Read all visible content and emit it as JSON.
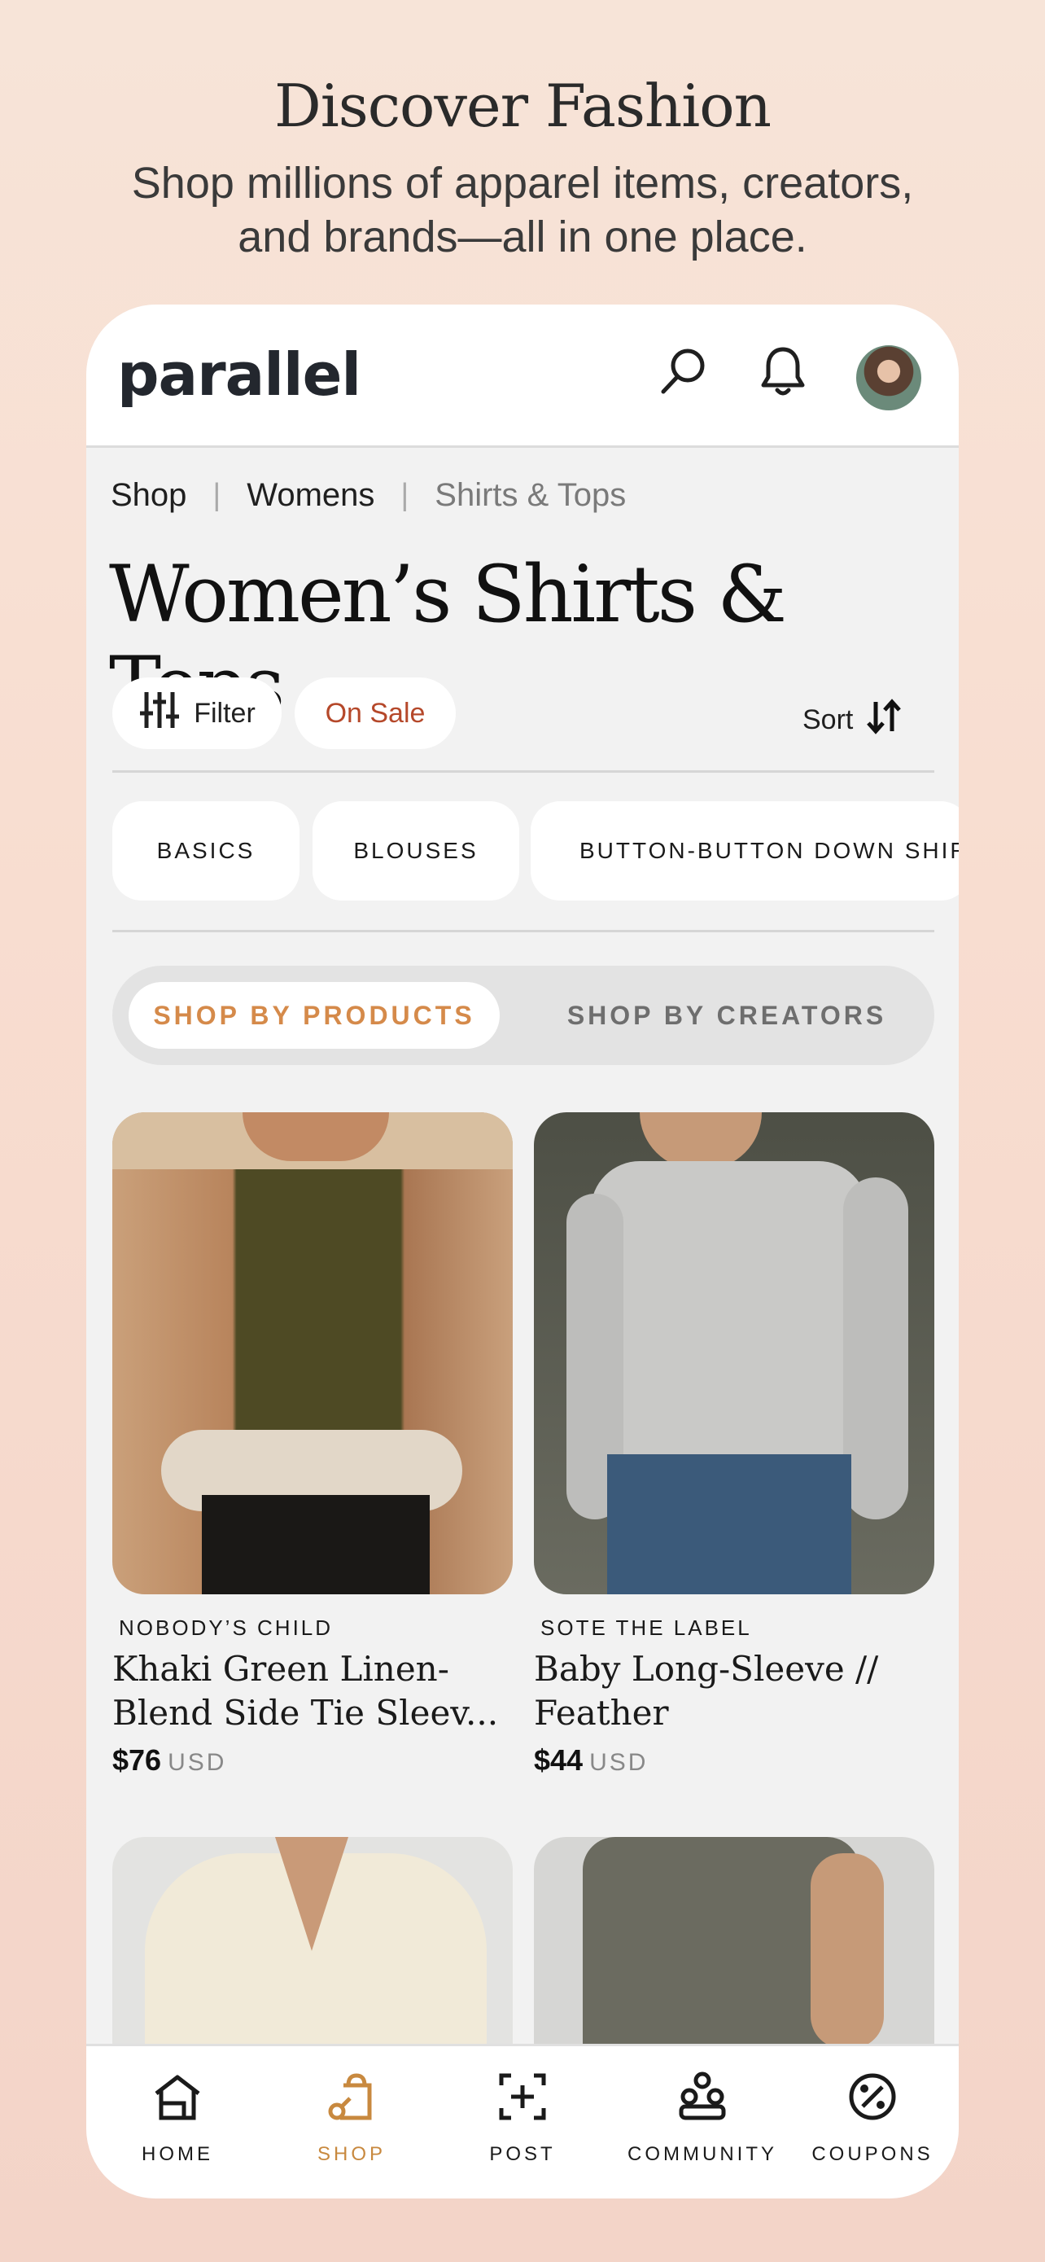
{
  "hero": {
    "title": "Discover Fashion",
    "subtitle": "Shop millions of apparel items, creators, and brands—all in one place."
  },
  "header": {
    "logo": "parallel",
    "search_icon": "search-icon",
    "notifications_icon": "bell-icon",
    "avatar": "avatar"
  },
  "breadcrumb": {
    "items": [
      "Shop",
      "Womens",
      "Shirts & Tops"
    ],
    "separator": "|"
  },
  "page": {
    "title": "Women’s Shirts & Tops"
  },
  "toolbar": {
    "filter_label": "Filter",
    "sale_label": "On Sale",
    "sort_label": "Sort"
  },
  "categories": [
    "BASICS",
    "BLOUSES",
    "BUTTON-BUTTON DOWN SHIRS"
  ],
  "segmented": {
    "products": "SHOP BY PRODUCTS",
    "creators": "SHOP BY CREATORS",
    "active": "products"
  },
  "products": [
    {
      "brand": "NOBODY’S CHILD",
      "name": "Khaki Green Linen-Blend Side Tie Sleev...",
      "price": "$76",
      "currency": "USD"
    },
    {
      "brand": "SOTE THE LABEL",
      "name": "Baby Long-Sleeve // Feather",
      "price": "$44",
      "currency": "USD"
    }
  ],
  "nav": {
    "items": [
      {
        "label": "HOME",
        "icon": "home-icon"
      },
      {
        "label": "SHOP",
        "icon": "shop-icon"
      },
      {
        "label": "POST",
        "icon": "post-icon"
      },
      {
        "label": "COMMUNITY",
        "icon": "community-icon"
      },
      {
        "label": "COUPONS",
        "icon": "coupons-icon"
      }
    ],
    "active": "SHOP"
  },
  "colors": {
    "accent": "#d58a4a",
    "sale": "#b5482a",
    "background": "#f2f2f2"
  }
}
